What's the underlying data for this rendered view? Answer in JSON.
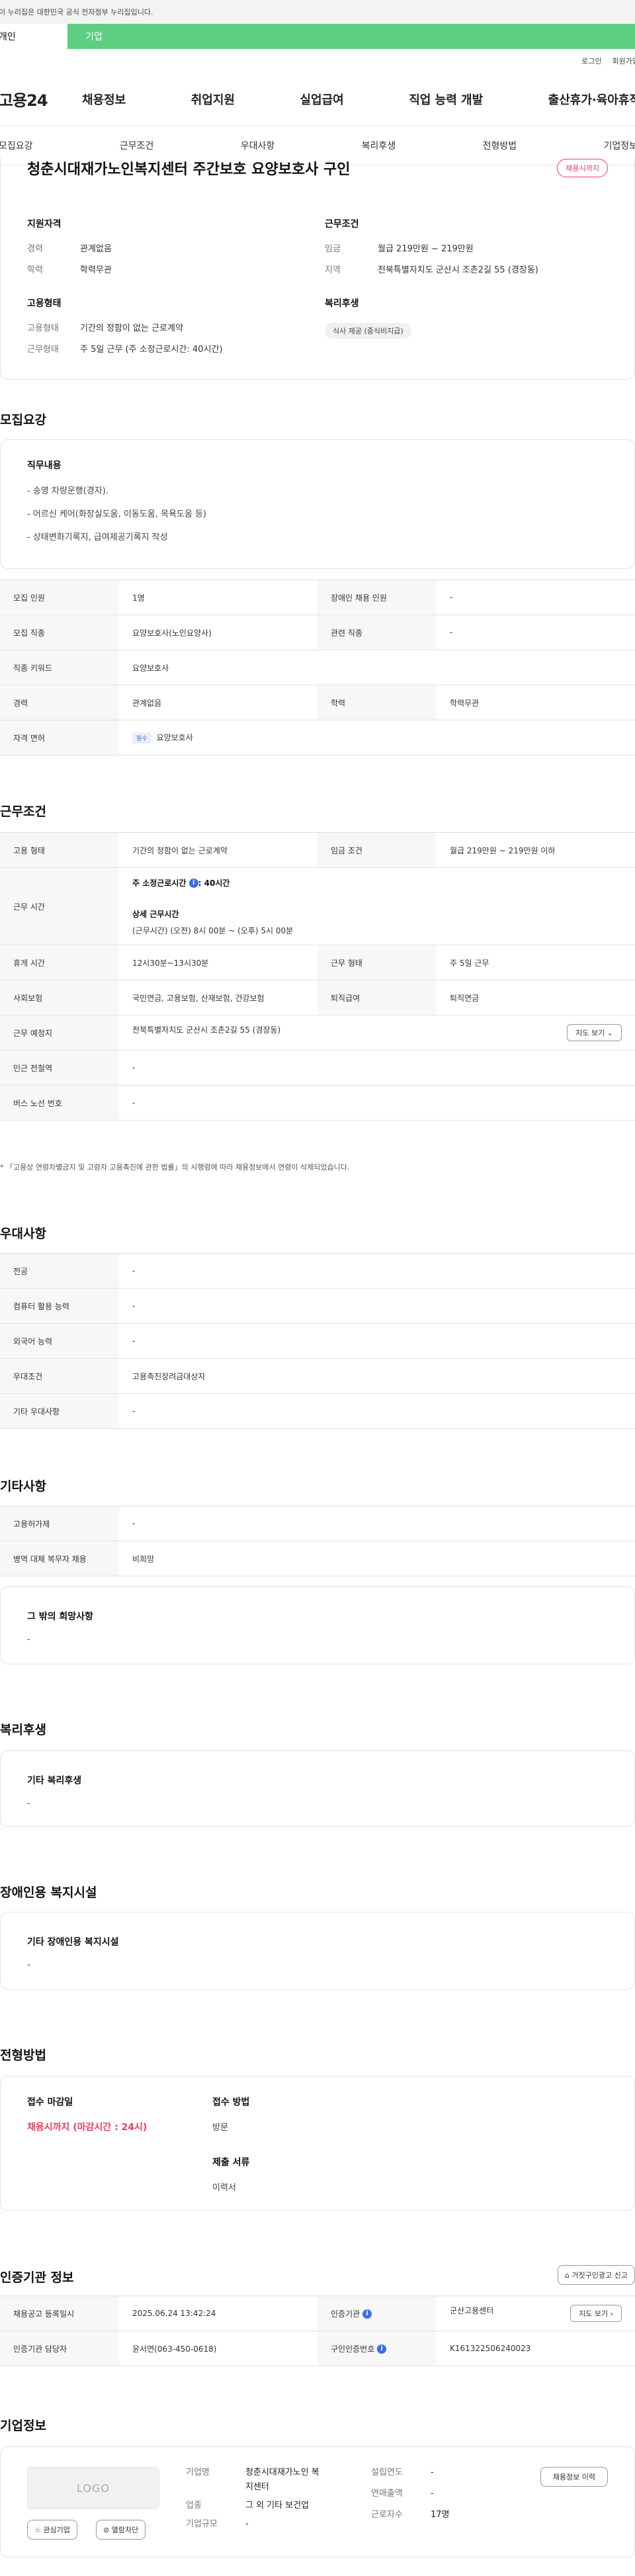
{
  "gov_bar": "이 누리집은 대한민국 공식 전자정부 누리집입니다.",
  "user_tabs": [
    "개인",
    "기업"
  ],
  "util": [
    "로그인",
    "회원가입"
  ],
  "logo": "고용24",
  "gnb": [
    "채용정보",
    "취업지원",
    "실업급여",
    "직업 능력 개발",
    "출산휴가·육아휴직"
  ],
  "anchors": [
    "모집요강",
    "근무조건",
    "우대사항",
    "복리후생",
    "전형방법",
    "기업정보"
  ],
  "summary": {
    "title": "청춘시대재가노인복지센터 주간보호 요양보호사 구인",
    "status_badge": "채용시까지",
    "qual": {
      "title": "지원자격",
      "rows": [
        {
          "k": "경력",
          "v": "관계없음"
        },
        {
          "k": "학력",
          "v": "학력무관"
        }
      ]
    },
    "cond": {
      "title": "근무조건",
      "rows": [
        {
          "k": "임금",
          "v": "월급 219만원 ~ 219만원"
        },
        {
          "k": "지역",
          "v": "전북특별자치도 군산시 조촌2길 55 (경장동)"
        }
      ]
    },
    "emp": {
      "title": "고용형태",
      "rows": [
        {
          "k": "고용형태",
          "v": "기간의 정함이 없는 근로계약"
        },
        {
          "k": "근무형태",
          "v": "주 5일 근무 (주 소정근로시간: 40시간)"
        }
      ]
    },
    "welfare": {
      "title": "복리후생",
      "chip": "식사 제공 (중식비지급)"
    }
  },
  "recruit": {
    "section": "모집요강",
    "duty_title": "직무내용",
    "duty_lines": [
      "- 송영 차량운행(경자).",
      "- 어르신 케어(화장실도움, 이동도움, 목욕도움 등)",
      "- 상태변화기록지, 급여제공기록지 작성"
    ],
    "rows": [
      [
        {
          "h": "모집 인원",
          "v": "1명"
        },
        {
          "h": "장애인 채용 인원",
          "v": "-"
        }
      ],
      [
        {
          "h": "모집 직종",
          "v": "요양보호사(노인요양사)"
        },
        {
          "h": "관련 직종",
          "v": "-"
        }
      ],
      [
        {
          "h": "직종 키워드",
          "v": "요양보호사"
        }
      ],
      [
        {
          "h": "경력",
          "v": "관계없음"
        },
        {
          "h": "학력",
          "v": "학력무관"
        }
      ],
      [
        {
          "h": "자격 면허",
          "v": "요양보호사",
          "tag": "필수"
        }
      ]
    ]
  },
  "work": {
    "section": "근무조건",
    "emp_type_h": "고용 형태",
    "emp_type_v": "기간의 정함이 없는 근로계약",
    "wage_h": "임금 조건",
    "wage_v": "월급 219만원 ~ 219만원 이하",
    "hours_h": "근무 시간",
    "hours_week": "주 소정근로시간",
    "hours_week_v": ": 40시간",
    "hours_detail_title": "상세 근무시간",
    "hours_detail": "(근무시간) (오전) 8시 00분 ~ (오후) 5시 00분",
    "break_h": "휴게 시간",
    "break_v": "12시30분~13시30분",
    "form_h": "근무 형태",
    "form_v": "주 5일 근무",
    "ins_h": "사회보험",
    "ins_v": "국민연금, 고용보험, 산재보험, 건강보험",
    "sev_h": "퇴직급여",
    "sev_v": "퇴직연금",
    "place_h": "근무 예정지",
    "place_v": "전북특별자치도 군산시 조촌2길 55 (경장동)",
    "map_btn": "지도 보기",
    "station_h": "인근 전철역",
    "station_v": "-",
    "bus_h": "버스 노선 번호",
    "bus_v": "-",
    "note": "* 「고용상 연령차별금지 및 고령자 고용촉진에 관한 법률」의 시행령에 따라 채용정보에서 연령이 삭제되었습니다."
  },
  "pref": {
    "section": "우대사항",
    "rows": [
      {
        "h": "전공",
        "v": "-"
      },
      {
        "h": "컴퓨터 활용 능력",
        "v": "-"
      },
      {
        "h": "외국어 능력",
        "v": "-"
      },
      {
        "h": "우대조건",
        "v": "고용촉진장려금대상자"
      },
      {
        "h": "기타 우대사항",
        "v": "-"
      }
    ]
  },
  "etc": {
    "section": "기타사항",
    "rows": [
      {
        "h": "고용허가제",
        "v": "-"
      },
      {
        "h": "병역 대체 복무자 채용",
        "v": "비희망"
      }
    ],
    "wish_title": "그 밖의 희망사항",
    "wish_v": "-"
  },
  "welfare": {
    "section": "복리후생",
    "title": "기타 복리후생",
    "v": "-"
  },
  "disabled": {
    "section": "장애인용 복지시설",
    "title": "기타 장애인용 복지시설",
    "v": "-"
  },
  "apply": {
    "section": "전형방법",
    "deadline_title": "접수 마감일",
    "deadline_v": "채용시까지 (마감시간 : 24시)",
    "method_title": "접수 방법",
    "method_v": "방문",
    "docs_title": "제출 서류",
    "docs_v": "이력서"
  },
  "cert": {
    "section": "인증기관 정보",
    "report_btn": "거짓구인광고 신고",
    "reg_h": "채용공고 등록일시",
    "reg_v": "2025.06.24 13:42:24",
    "org_h": "인증기관",
    "org_v": "군산고용센터",
    "map_btn": "지도 보기",
    "mgr_h": "인증기관 담당자",
    "mgr_v": "윤서연(063-450-0618)",
    "num_h": "구인인증번호",
    "num_v": "K161322506240023"
  },
  "company": {
    "section": "기업정보",
    "logo": "LOGO",
    "interest_btn": "관심기업",
    "block_btn": "열람차단",
    "name_k": "기업명",
    "name_v": "청춘시대재가노인 복지센터",
    "industry_k": "업종",
    "industry_v": "그 외 기타 보건업",
    "scale_k": "기업규모",
    "scale_v": "-",
    "year_k": "설립연도",
    "year_v": "-",
    "sales_k": "연매출액",
    "sales_v": "-",
    "staff_k": "근로자수",
    "staff_v": "17명",
    "history_btn": "채용정보 이력"
  }
}
